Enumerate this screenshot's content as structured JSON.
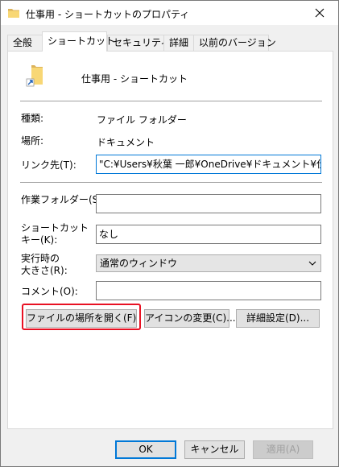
{
  "window": {
    "title": "仕事用 - ショートカットのプロパティ"
  },
  "tabs": [
    {
      "label": "全般",
      "active": false
    },
    {
      "label": "ショートカット",
      "active": true
    },
    {
      "label": "セキュリティ",
      "active": false
    },
    {
      "label": "詳細",
      "active": false
    },
    {
      "label": "以前のバージョン",
      "active": false
    }
  ],
  "shortcut": {
    "name": "仕事用 - ショートカット"
  },
  "info": {
    "type_label": "種類:",
    "type_value": "ファイル フォルダー",
    "location_label": "場所:",
    "location_value": "ドキュメント",
    "link_label": "リンク先(T):",
    "link_value": "\"C:¥Users¥秋葉 一郎¥OneDrive¥ドキュメント¥仕事用\""
  },
  "fields": {
    "workdir_label": "作業フォルダー(S):",
    "workdir_value": "",
    "hotkey_label_1": "ショートカット",
    "hotkey_label_2": "キー(K):",
    "hotkey_value": "なし",
    "run_label_1": "実行時の",
    "run_label_2": "大きさ(R):",
    "run_value": "通常のウィンドウ",
    "comment_label": "コメント(O):",
    "comment_value": ""
  },
  "actions": {
    "open_location": "ファイルの場所を開く(F)",
    "change_icon": "アイコンの変更(C)...",
    "advanced": "詳細設定(D)..."
  },
  "footer": {
    "ok": "OK",
    "cancel": "キャンセル",
    "apply": "適用(A)"
  },
  "colors": {
    "accent": "#0078d7",
    "highlight": "#e81123"
  }
}
